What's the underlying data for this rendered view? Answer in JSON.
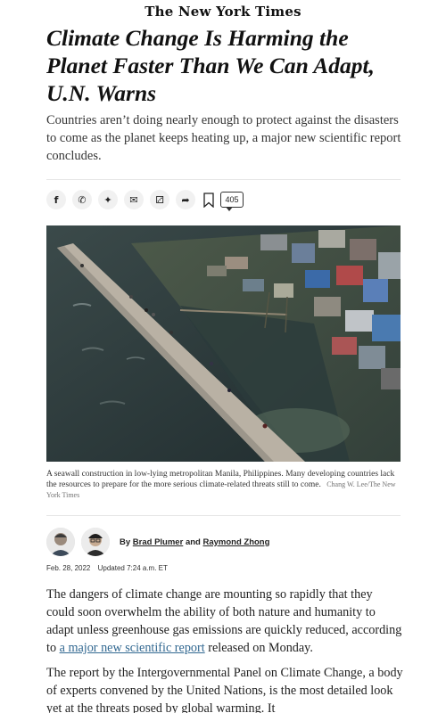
{
  "masthead": {
    "title": "The New York Times"
  },
  "article": {
    "headline": "Climate Change Is Harming the Planet Faster Than We Can Adapt, U.N. Warns",
    "summary": "Countries aren’t doing nearly enough to protect against the disasters to come as the planet keeps heating up, a major new scientific report concludes.",
    "comment_count": "405",
    "photo": {
      "caption": "A seawall construction in low-lying metropolitan Manila, Philippines. Many developing countries lack the resources to prepare for the more serious climate-related threats still to come.",
      "credit": "Chang W. Lee/The New York Times"
    },
    "byline": {
      "prefix": "By",
      "author1": "Brad Plumer",
      "and": "and",
      "author2": "Raymond Zhong"
    },
    "date": "Feb. 28, 2022",
    "updated": "Updated 7:24 a.m. ET",
    "para1_before_link": "The dangers of climate change are mounting so rapidly that they could soon overwhelm the ability of both nature and humanity to adapt unless greenhouse gas emissions are quickly reduced, according to",
    "para1_link": "a major new scientific report",
    "para1_after_link": "released on Monday.",
    "para2": "The report by the Intergovernmental Panel on Climate Change, a body of experts convened by the United Nations, is the most detailed look yet at the threats posed by global warming. It"
  },
  "share_buttons": [
    {
      "icon": "facebook-icon",
      "glyph": "f"
    },
    {
      "icon": "whatsapp-icon",
      "glyph": "✆"
    },
    {
      "icon": "twitter-icon",
      "glyph": "✦"
    },
    {
      "icon": "email-icon",
      "glyph": "✉"
    },
    {
      "icon": "gift-icon",
      "glyph": "⚂"
    },
    {
      "icon": "share-icon",
      "glyph": "➦"
    }
  ],
  "colors": {
    "link": "#326891",
    "text": "#121212",
    "summary": "#363636"
  }
}
